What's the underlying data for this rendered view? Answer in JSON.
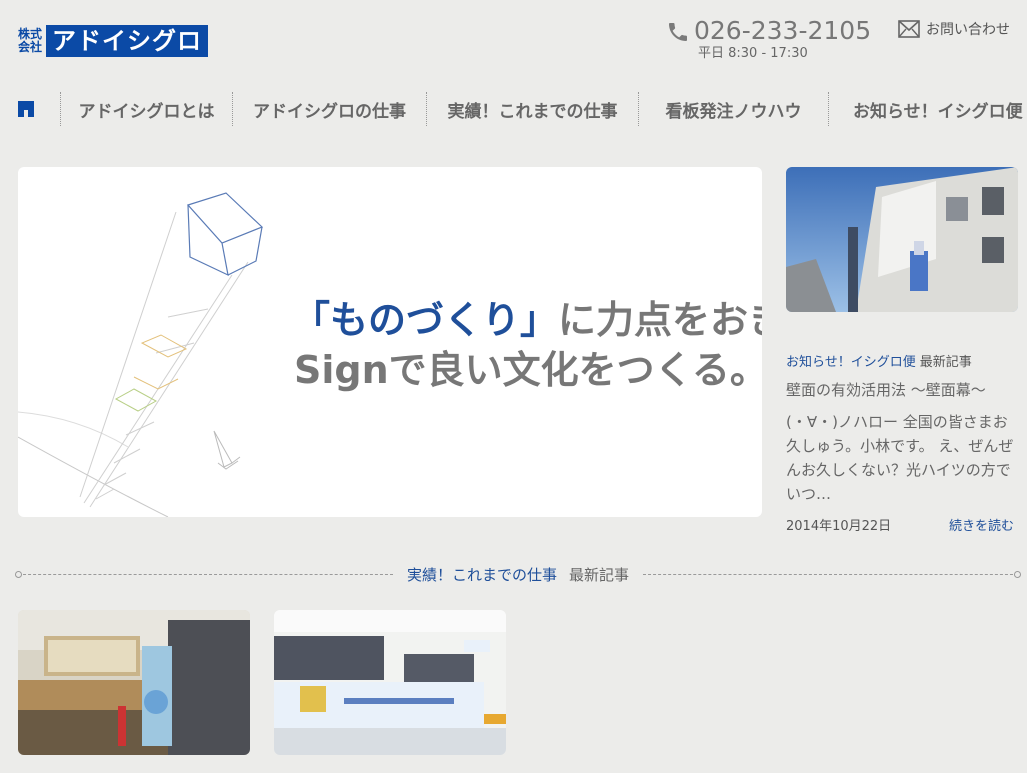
{
  "header": {
    "logo_small_1": "株式",
    "logo_small_2": "会社",
    "logo_main": "アドイシグロ",
    "phone_number": "026-233-2105",
    "phone_hours": "平日 8:30 - 17:30",
    "contact_label": "お問い合わせ"
  },
  "nav": {
    "items": [
      "アドイシグロとは",
      "アドイシグロの仕事",
      "実績！これまでの仕事",
      "看板発注ノウハウ",
      "お知らせ！イシグロ便"
    ]
  },
  "hero": {
    "line1_accent": "「ものづくり」",
    "line1_rest": "に力点をおき、",
    "line2": "Signで良い文化をつくる。"
  },
  "news": {
    "category": "お知らせ！イシグロ便",
    "tag": "最新記事",
    "title": "壁面の有効活用法 ～壁面幕～",
    "excerpt": "(・∀・)ノハロー 全国の皆さまお久しゅう。小林です。 え、ぜんぜんお久しくない？光ハイツの方でいつ…",
    "date": "2014年10月22日",
    "more": "続きを読む"
  },
  "works_section": {
    "category": "実績！これまでの仕事",
    "tag": "最新記事"
  },
  "colors": {
    "brand": "#0b4aa6",
    "accent_text": "#1f4f9a",
    "background": "#ececea"
  }
}
